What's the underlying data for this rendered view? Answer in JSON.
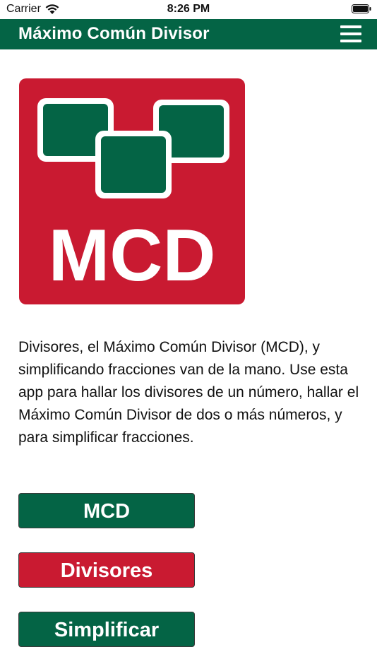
{
  "status_bar": {
    "carrier": "Carrier",
    "time": "8:26 PM"
  },
  "nav": {
    "title": "Máximo Común Divisor",
    "menu_icon": "hamburger-menu-icon"
  },
  "logo": {
    "text": "MCD",
    "background_color": "#c91a31",
    "square_color": "#046445"
  },
  "description": "Divisores, el Máximo Común Divisor (MCD), y simplificando fracciones van de la mano. Use esta app para hallar los divisores de un número, hallar el Máximo Común Divisor de dos o más números, y para simplificar fracciones.",
  "buttons": {
    "mcd": "MCD",
    "divisores": "Divisores",
    "simplificar": "Simplificar"
  },
  "colors": {
    "primary_green": "#046445",
    "accent_red": "#c91a31"
  }
}
